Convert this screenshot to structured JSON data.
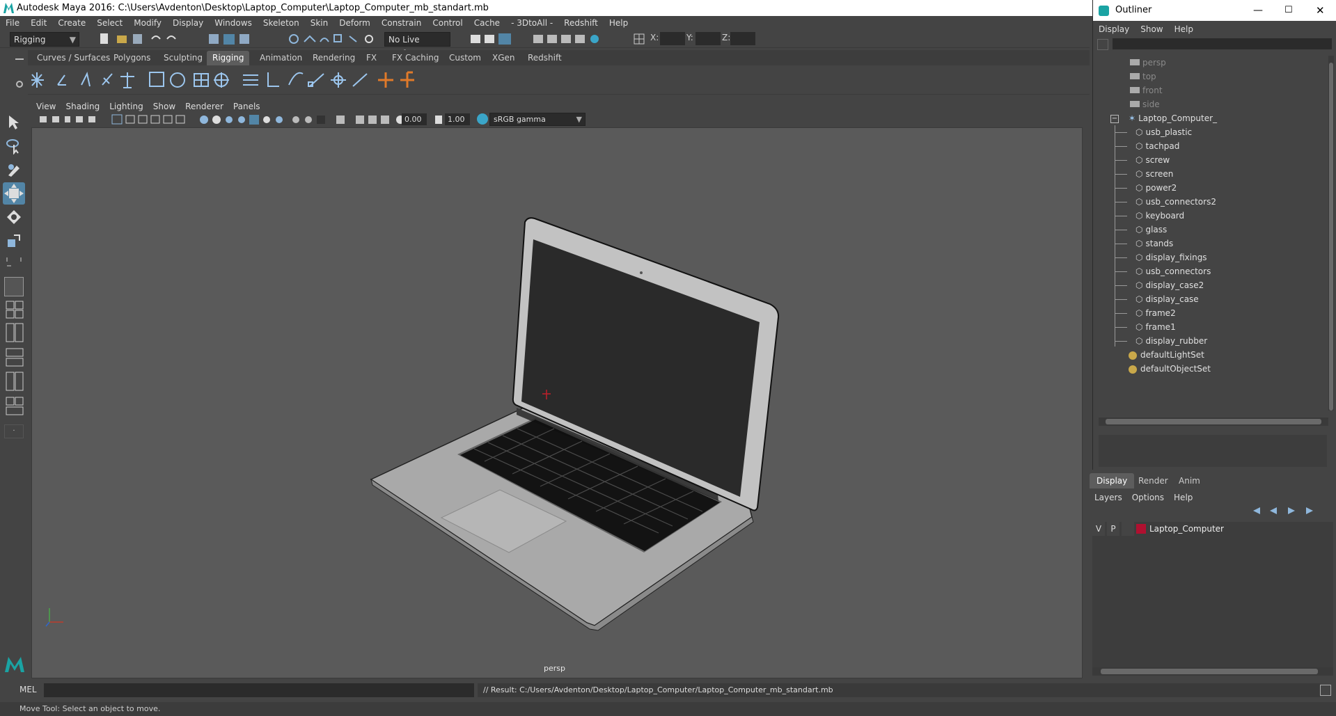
{
  "window": {
    "title": "Autodesk Maya 2016: C:\\Users\\Avdenton\\Desktop\\Laptop_Computer\\Laptop_Computer_mb_standart.mb"
  },
  "menubar": [
    "File",
    "Edit",
    "Create",
    "Select",
    "Modify",
    "Display",
    "Windows",
    "Skeleton",
    "Skin",
    "Deform",
    "Constrain",
    "Control",
    "Cache",
    "- 3DtoAll -",
    "Redshift",
    "Help"
  ],
  "statusline": {
    "menuset": "Rigging",
    "live_surface": "No Live Surface",
    "x_label": "X:",
    "y_label": "Y:",
    "z_label": "Z:"
  },
  "shelf_tabs": [
    "Curves / Surfaces",
    "Polygons",
    "Sculpting",
    "Rigging",
    "Animation",
    "Rendering",
    "FX",
    "FX Caching",
    "Custom",
    "XGen",
    "Redshift"
  ],
  "shelf_active": "Rigging",
  "viewport_menu": [
    "View",
    "Shading",
    "Lighting",
    "Show",
    "Renderer",
    "Panels"
  ],
  "viewport_toolbar": {
    "exposure": "0.00",
    "gamma": "1.00",
    "color_space": "sRGB gamma"
  },
  "viewport": {
    "camera_label": "persp"
  },
  "command_line": {
    "lang": "MEL",
    "result": "// Result: C:/Users/Avdenton/Desktop/Laptop_Computer/Laptop_Computer_mb_standart.mb"
  },
  "help_line": "Move Tool: Select an object to move.",
  "outliner": {
    "title": "Outliner",
    "menu": [
      "Display",
      "Show",
      "Help"
    ],
    "cameras": [
      "persp",
      "top",
      "front",
      "side"
    ],
    "group": "Laptop_Computer_",
    "children": [
      "usb_plastic",
      "tachpad",
      "screw",
      "screen",
      "power2",
      "usb_connectors2",
      "keyboard",
      "glass",
      "stands",
      "display_fixings",
      "usb_connectors",
      "display_case2",
      "display_case",
      "frame2",
      "frame1",
      "display_rubber"
    ],
    "sets": [
      "defaultLightSet",
      "defaultObjectSet"
    ]
  },
  "layer_editor": {
    "tabs": [
      "Display",
      "Render",
      "Anim"
    ],
    "active_tab": "Display",
    "menu": [
      "Layers",
      "Options",
      "Help"
    ],
    "layer": {
      "v": "V",
      "p": "P",
      "name": "Laptop_Computer",
      "color": "#b01030"
    }
  },
  "colors": {
    "accent": "#5285a6",
    "maya_teal": "#1aa3a3"
  }
}
